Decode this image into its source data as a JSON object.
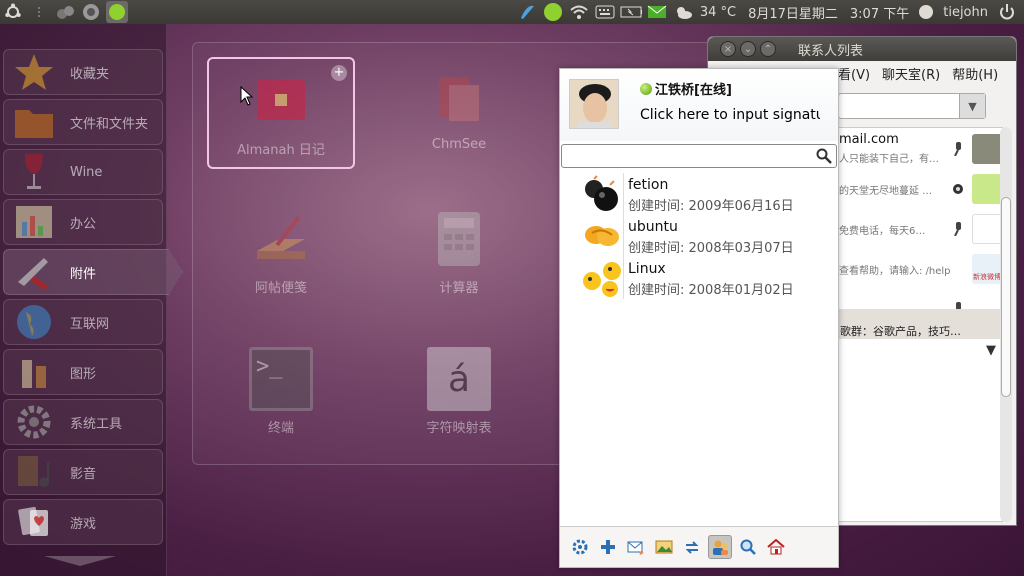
{
  "top_panel": {
    "weather": "34 °C",
    "date": "8月17日星期二",
    "time": "3:07 下午",
    "user": "tiejohn"
  },
  "launcher": {
    "categories": [
      {
        "label": "收藏夹",
        "icon": "star-icon"
      },
      {
        "label": "文件和文件夹",
        "icon": "folder-icon"
      },
      {
        "label": "Wine",
        "icon": "wine-glass-icon"
      },
      {
        "label": "办公",
        "icon": "office-chart-icon"
      },
      {
        "label": "附件",
        "icon": "accessories-knife-icon"
      },
      {
        "label": "互联网",
        "icon": "globe-icon"
      },
      {
        "label": "图形",
        "icon": "paint-tube-icon"
      },
      {
        "label": "系统工具",
        "icon": "gear-icon"
      },
      {
        "label": "影音",
        "icon": "film-music-icon"
      },
      {
        "label": "游戏",
        "icon": "playing-cards-icon"
      }
    ],
    "active_index": 4
  },
  "dash": {
    "apps": [
      {
        "label": "Almanah 日记",
        "icon": "diary-icon"
      },
      {
        "label": "ChmSee",
        "icon": "chm-books-icon"
      },
      {
        "label": "阿帖便笺",
        "icon": "note-pen-icon"
      },
      {
        "label": "计算器",
        "icon": "calculator-icon"
      },
      {
        "label": "终端",
        "icon": "terminal-icon"
      },
      {
        "label": "字符映射表",
        "icon": "character-map-icon"
      }
    ],
    "selected_index": 0,
    "terminal_glyph": ">_",
    "charmap_glyph": "á",
    "add_glyph": "+"
  },
  "contact_window": {
    "title": "联系人列表",
    "menu": [
      "看(V)",
      "聊天室(R)",
      "帮助(H)"
    ],
    "rows": [
      {
        "main": "mail.com",
        "sub": "人只能装下自己，有…"
      },
      {
        "main": "",
        "sub": "的天堂无尽地蔓延 …"
      },
      {
        "main": "",
        "sub": "免费电话，每天6…"
      },
      {
        "main": "",
        "sub": "查看帮助，请输入: /help"
      }
    ],
    "weibo_label": "新浪微博",
    "group_label": "歌群：谷歌产品，技巧…"
  },
  "fetion": {
    "user_name": "江铁桥",
    "status": "[在线]",
    "signature": "Click here to input signature",
    "search_value": "",
    "contacts": [
      {
        "name": "fetion",
        "created": "创建时间: 2009年06月16日",
        "icon": "bomb-icon"
      },
      {
        "name": "ubuntu",
        "created": "创建时间: 2008年03月07日",
        "icon": "handshake-icon"
      },
      {
        "name": "Linux",
        "created": "创建时间: 2008年01月02日",
        "icon": "smiley-group-icon"
      }
    ],
    "toolbar": [
      "settings-icon",
      "add-contact-icon",
      "send-message-icon",
      "photo-icon",
      "sync-icon",
      "contacts-icon",
      "search-icon",
      "home-icon"
    ],
    "toolbar_active_index": 5
  },
  "colors": {
    "panel_bg": "#3c3b37",
    "fetion_status_green": "#5a9d12",
    "selection_border": "#f0c8e6"
  }
}
